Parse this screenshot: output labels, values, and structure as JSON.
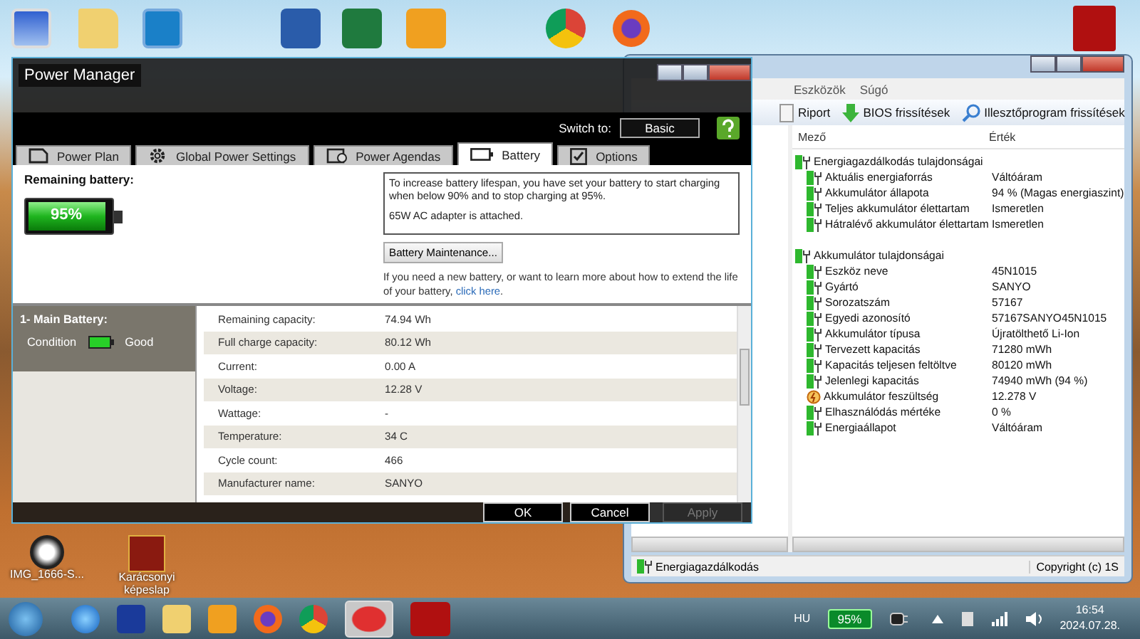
{
  "desktop_icons": [
    {
      "label": "IMG_1666-S..."
    },
    {
      "label": "Karácsonyi képeslap"
    }
  ],
  "power_manager": {
    "title": "Power Manager",
    "switch_label": "Switch to:",
    "switch_button": "Basic",
    "tabs": [
      {
        "label": "Power Plan",
        "selected": false,
        "kind": "plan"
      },
      {
        "label": "Global Power Settings",
        "selected": false,
        "kind": "settings"
      },
      {
        "label": "Power Agendas",
        "selected": false,
        "kind": "agenda"
      },
      {
        "label": "Battery",
        "selected": true,
        "kind": "battery"
      },
      {
        "label": "Options",
        "selected": false,
        "kind": "options"
      }
    ],
    "remaining_label": "Remaining battery:",
    "battery": {
      "level": 0.95,
      "text": "95%"
    },
    "info_lines": [
      "To increase battery lifespan, you have set your battery to start charging when below 90% and to stop charging at 95%.",
      "65W AC adapter is attached."
    ],
    "maintenance_button": "Battery Maintenance...",
    "help_text": "If you need a new battery, or want to learn more about how to extend the life of your battery,",
    "help_link": "click here",
    "help_end": ".",
    "battery_list": {
      "title": "1- Main Battery:",
      "condition_label": "Condition",
      "condition_value": "Good"
    },
    "details": [
      {
        "label": "Remaining capacity:",
        "value": "74.94 Wh"
      },
      {
        "label": "Full charge capacity:",
        "value": "80.12 Wh"
      },
      {
        "label": "Current:",
        "value": "0.00 A"
      },
      {
        "label": "Voltage:",
        "value": "12.28 V"
      },
      {
        "label": "Wattage:",
        "value": "-"
      },
      {
        "label": "Temperature:",
        "value": "34 C"
      },
      {
        "label": "Cycle count:",
        "value": "466"
      },
      {
        "label": "Manufacturer name:",
        "value": "SANYO"
      }
    ],
    "buttons": [
      {
        "label": "OK",
        "disabled": false
      },
      {
        "label": "Cancel",
        "disabled": false
      },
      {
        "label": "Apply",
        "disabled": true
      }
    ]
  },
  "aida": {
    "menu": [
      "Eszközök",
      "Súgó"
    ],
    "toolbar": [
      {
        "label": "Riport",
        "kind": "report"
      },
      {
        "label": "BIOS frissítések",
        "kind": "download"
      },
      {
        "label": "Illesztőprogram frissítések",
        "kind": "search"
      }
    ],
    "columns": [
      "Mező",
      "Érték"
    ],
    "groups": [
      {
        "title": "Energiagazdálkodás tulajdonságai",
        "rows": [
          {
            "field": "Aktuális energiaforrás",
            "value": "Váltóáram",
            "kind": "battery"
          },
          {
            "field": "Akkumulátor állapota",
            "value": "94 % (Magas energiaszint)",
            "kind": "battery"
          },
          {
            "field": "Teljes akkumulátor élettartam",
            "value": "Ismeretlen",
            "kind": "battery"
          },
          {
            "field": "Hátralévő akkumulátor élettartam",
            "value": "Ismeretlen",
            "kind": "battery"
          }
        ]
      },
      {
        "title": "Akkumulátor tulajdonságai",
        "rows": [
          {
            "field": "Eszköz neve",
            "value": "45N1015",
            "kind": "battery"
          },
          {
            "field": "Gyártó",
            "value": "SANYO",
            "kind": "battery"
          },
          {
            "field": "Sorozatszám",
            "value": "57167",
            "kind": "battery"
          },
          {
            "field": "Egyedi azonosító",
            "value": "57167SANYO45N1015",
            "kind": "battery"
          },
          {
            "field": "Akkumulátor típusa",
            "value": "Újratölthető Li-Ion",
            "kind": "battery"
          },
          {
            "field": "Tervezett kapacitás",
            "value": "71280 mWh",
            "kind": "battery"
          },
          {
            "field": "Kapacitás teljesen feltöltve",
            "value": "80120 mWh",
            "kind": "battery"
          },
          {
            "field": "Jelenlegi kapacitás",
            "value": "74940 mWh  (94 %)",
            "kind": "battery"
          },
          {
            "field": "Akkumulátor feszültség",
            "value": "12.278 V",
            "kind": "voltage"
          },
          {
            "field": "Elhasználódás mértéke",
            "value": "0 %",
            "kind": "battery"
          },
          {
            "field": "Energiaállapot",
            "value": "Váltóáram",
            "kind": "battery"
          }
        ]
      }
    ],
    "status_left": "Energiagazdálkodás",
    "status_right": "Copyright (c) 1S"
  },
  "taskbar": {
    "language": "HU",
    "battery_text": "95%",
    "time": "16:54",
    "date": "2024.07.28."
  }
}
